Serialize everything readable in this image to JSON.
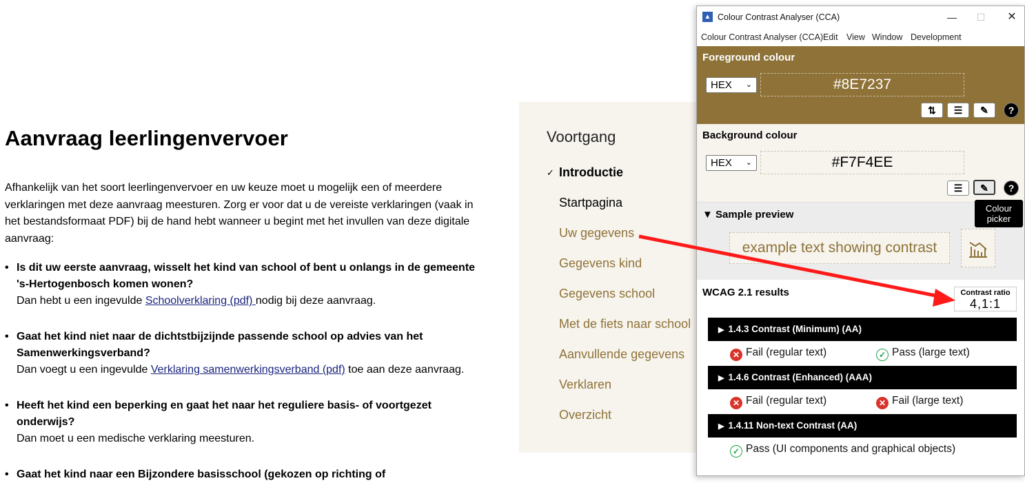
{
  "page": {
    "title": "Aanvraag leerlingenvervoer",
    "intro": "Afhankelijk van het soort leerlingenvervoer en uw keuze moet u mogelijk een of meerdere verklaringen met deze aanvraag meesturen. Zorg er voor dat u de vereiste verklaringen (vaak in het bestandsformaat PDF) bij de hand hebt wanneer u begint met het invullen van deze digitale aanvraag:",
    "questions": [
      {
        "q": "Is dit uw eerste aanvraag, wisselt het kind van school of bent u onlangs in de gemeente 's-Hertogenbosch komen wonen?",
        "pre": "Dan hebt u een ingevulde ",
        "link": "Schoolverklaring (pdf) ",
        "post": "nodig bij deze aanvraag."
      },
      {
        "q": "Gaat het kind niet naar de dichtstbijzijnde passende school op advies van het Samenwerkingsverband?",
        "pre": "Dan voegt u een ingevulde ",
        "link": "Verklaring samenwerkingsverband (pdf)",
        "post": " toe aan deze aanvraag."
      },
      {
        "q": "Heeft het kind een beperking en gaat het naar het reguliere basis- of voortgezet onderwijs?",
        "pre": "Dan moet u een medische verklaring meesturen.",
        "link": "",
        "post": ""
      },
      {
        "q": "Gaat het kind naar een Bijzondere basisschool (gekozen op richting of",
        "pre": "",
        "link": "",
        "post": ""
      }
    ],
    "bullet": "•"
  },
  "progress": {
    "title": "Voortgang",
    "check": "✓",
    "steps": [
      "Introductie",
      "Startpagina",
      "Uw gegevens",
      "Gegevens kind",
      "Gegevens school",
      "Met de fiets naar school",
      "Aanvullende gegevens",
      "Verklaren",
      "Overzicht"
    ]
  },
  "cca": {
    "window_title": "Colour Contrast Analyser (CCA)",
    "window_buttons": {
      "minimize": "—",
      "maximize": "☐",
      "close": "✕"
    },
    "menu": [
      "Colour Contrast Analyser (CCA)",
      "Edit",
      "View",
      "Window",
      "Development"
    ],
    "foreground": {
      "title": "Foreground colour",
      "format": "HEX",
      "value": "#8E7237",
      "color": "#8E7237"
    },
    "background": {
      "title": "Background colour",
      "format": "HEX",
      "value": "#F7F4EE",
      "color": "#F7F4EE"
    },
    "tool_icons": {
      "swap": "⇅",
      "sliders": "☰",
      "picker": "✎",
      "help": "?"
    },
    "preview": {
      "title": "Sample preview",
      "toggle": "▼",
      "sample_text": "example text showing contrast",
      "sample_icon": "chart-icon"
    },
    "tooltip": "Colour picker",
    "wcag": {
      "title": "WCAG 2.1 results",
      "ratio_label": "Contrast ratio",
      "ratio_value": "4,1:1",
      "criteria": [
        {
          "label": "1.4.3 Contrast (Minimum) (AA)",
          "results": [
            {
              "status": "fail",
              "text": "Fail (regular text)"
            },
            {
              "status": "pass",
              "text": "Pass (large text)"
            }
          ]
        },
        {
          "label": "1.4.6 Contrast (Enhanced) (AAA)",
          "results": [
            {
              "status": "fail",
              "text": "Fail (regular text)"
            },
            {
              "status": "fail",
              "text": "Fail (large text)"
            }
          ]
        },
        {
          "label": "1.4.11 Non-text Contrast (AA)",
          "results": [
            {
              "status": "pass",
              "text": "Pass (UI components and graphical objects)"
            }
          ]
        }
      ],
      "expand": "▶",
      "fail_symbol": "✕",
      "pass_symbol": "✓"
    }
  },
  "annotation": {
    "arrow_color": "#ff1a1a"
  }
}
